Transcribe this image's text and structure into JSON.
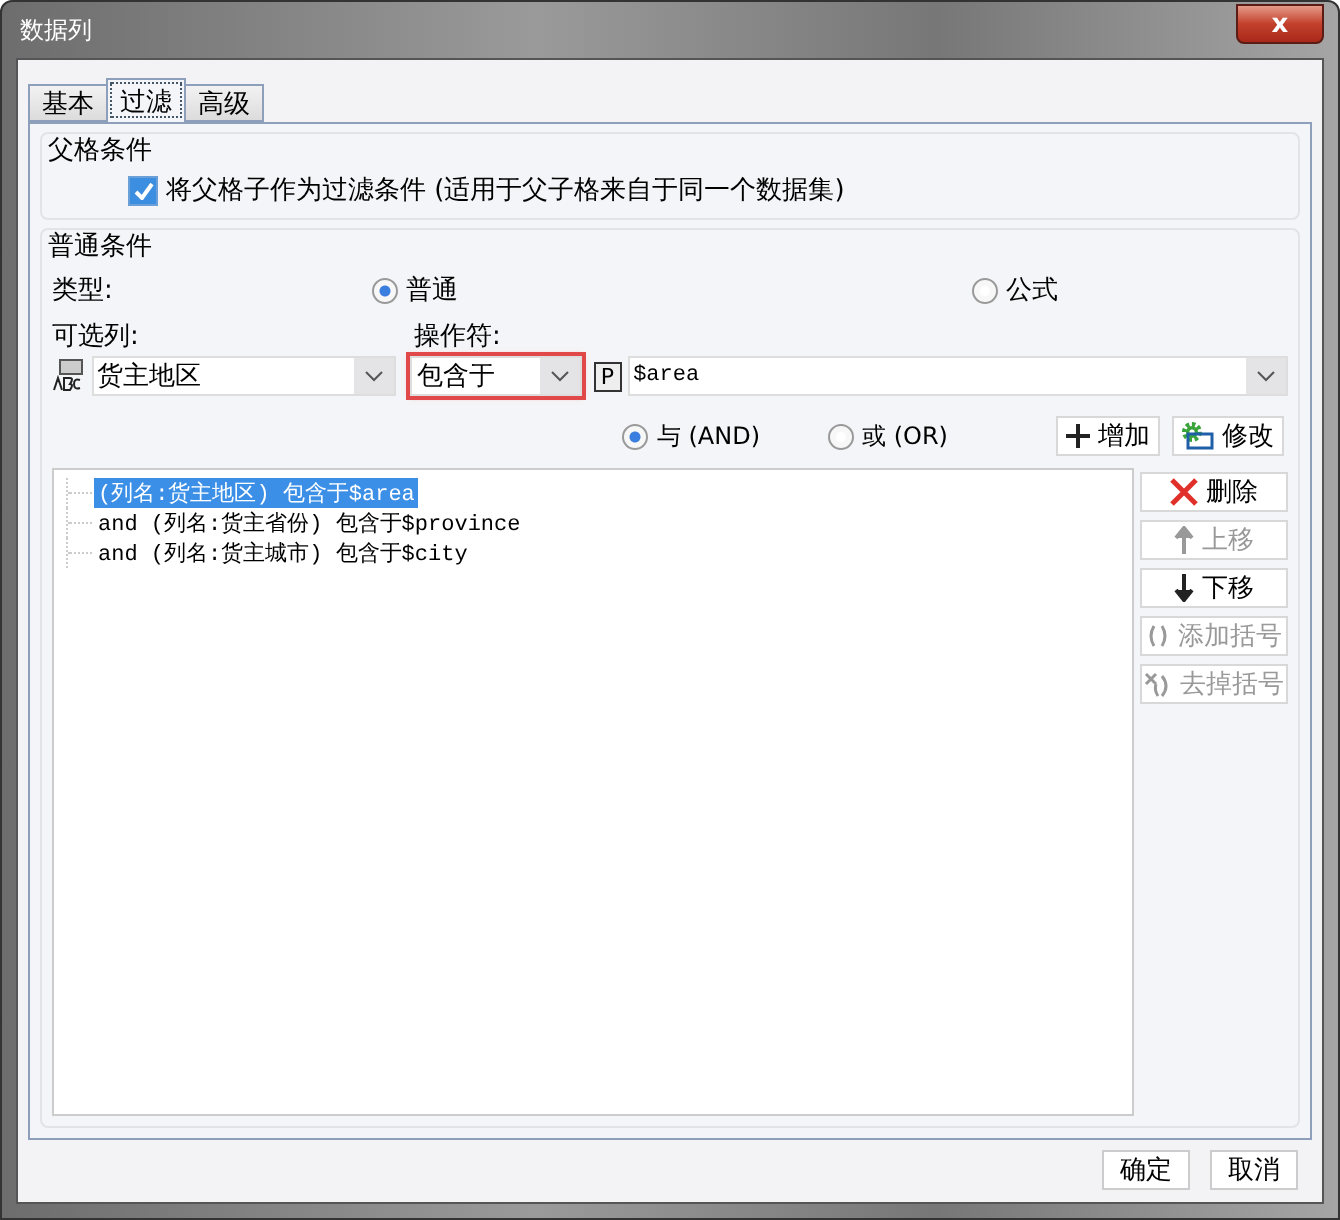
{
  "window": {
    "title": "数据列",
    "close": "x"
  },
  "tabs": [
    {
      "label": "基本",
      "selected": false
    },
    {
      "label": "过滤",
      "selected": true
    },
    {
      "label": "高级",
      "selected": false
    }
  ],
  "parent_condition": {
    "title": "父格条件",
    "checkbox": {
      "label": "将父格子作为过滤条件 (适用于父子格来自于同一个数据集)",
      "checked": true
    }
  },
  "normal_condition": {
    "title": "普通条件",
    "type_label": "类型:",
    "types": [
      {
        "label": "普通",
        "selected": true
      },
      {
        "label": "公式",
        "selected": false
      }
    ],
    "column_label": "可选列:",
    "column_value": "货主地区",
    "operator_label": "操作符:",
    "operator_value": "包含于",
    "operator_highlighted": true,
    "param_button": "P",
    "value": "$area",
    "joins": [
      {
        "label": "与 (AND)",
        "selected": true
      },
      {
        "label": "或 (OR)",
        "selected": false
      }
    ],
    "top_buttons": [
      {
        "kind": "add",
        "label": "增加",
        "disabled": false
      },
      {
        "kind": "edit",
        "label": "修改",
        "disabled": false
      }
    ],
    "conditions": [
      {
        "text": "(列名:货主地区) 包含于$area",
        "selected": true
      },
      {
        "text": "and (列名:货主省份) 包含于$province",
        "selected": false
      },
      {
        "text": "and (列名:货主城市) 包含于$city",
        "selected": false
      }
    ],
    "side_buttons": [
      {
        "kind": "delete",
        "label": "删除",
        "disabled": false
      },
      {
        "kind": "up",
        "label": "上移",
        "disabled": true
      },
      {
        "kind": "down",
        "label": "下移",
        "disabled": false
      },
      {
        "kind": "add-paren",
        "label": "添加括号",
        "disabled": true
      },
      {
        "kind": "remove-paren",
        "label": "去掉括号",
        "disabled": true
      }
    ]
  },
  "footer_buttons": [
    "确定",
    "取消"
  ]
}
